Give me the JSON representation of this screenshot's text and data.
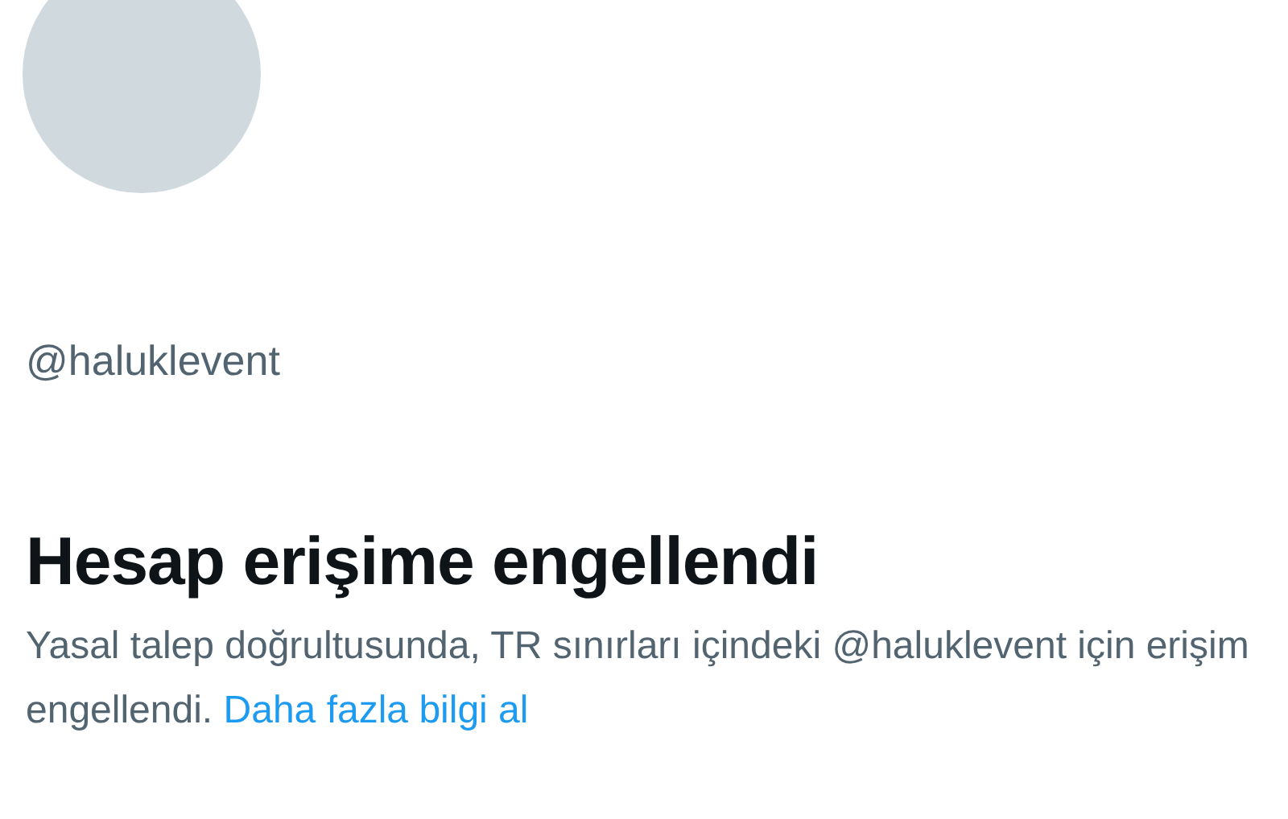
{
  "profile": {
    "handle": "@haluklevent"
  },
  "notice": {
    "title": "Hesap erişime engellendi",
    "message": "Yasal talep doğrultusunda, TR sınırları içindeki @haluklevent için erişim engellendi.",
    "link": "Daha fazla bilgi al"
  }
}
